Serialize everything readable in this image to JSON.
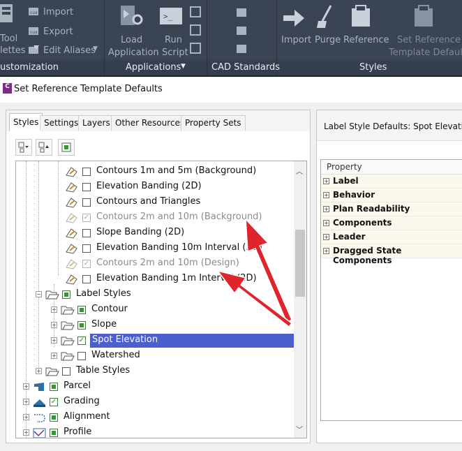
{
  "ribbon": {
    "customization": {
      "items": [
        "Import",
        "Export",
        "Edit Aliases"
      ],
      "left_fragments": [
        "Tool",
        "lettes"
      ],
      "title": "ustomization"
    },
    "applications": {
      "load_line1": "Load",
      "load_line2": "Application",
      "run_line1": "Run",
      "run_line2": "Script",
      "title": "Applications"
    },
    "cad_standards": {
      "title": "CAD Standards"
    },
    "styles": {
      "import": "Import",
      "purge": "Purge",
      "reference": "Reference",
      "set_ref_line1": "Set Reference",
      "set_ref_line2": "Template Defaults",
      "title": "Styles"
    }
  },
  "dialog": {
    "app_letter": "C",
    "title": "Set Reference Template Defaults"
  },
  "tabs": [
    "Styles",
    "Settings",
    "Layers",
    "Other Resources",
    "Property Sets"
  ],
  "tree": [
    {
      "label": "Contours 1m and 5m (Background)",
      "dim": false
    },
    {
      "label": "Elevation Banding (2D)",
      "dim": false
    },
    {
      "label": "Contours and Triangles",
      "dim": false
    },
    {
      "label": "Contours 2m and 10m (Background)",
      "dim": true
    },
    {
      "label": "Slope Banding (2D)",
      "dim": false
    },
    {
      "label": "Elevation Banding 10m Interval (2D)",
      "dim": false
    },
    {
      "label": "Contours 2m and 10m (Design)",
      "dim": true
    },
    {
      "label": "Elevation Banding 1m Interval (2D)",
      "dim": false
    },
    {
      "label": "Label Styles"
    },
    {
      "label": "Contour"
    },
    {
      "label": "Slope"
    },
    {
      "label": "Spot Elevation",
      "selected": true
    },
    {
      "label": "Watershed"
    },
    {
      "label": "Table Styles"
    },
    {
      "label": "Parcel"
    },
    {
      "label": "Grading"
    },
    {
      "label": "Alignment"
    },
    {
      "label": "Profile"
    }
  ],
  "right": {
    "heading": "Label Style Defaults: Spot Elevation",
    "column": "Property",
    "groups": [
      "Label",
      "Behavior",
      "Plan Readability",
      "Components",
      "Leader",
      "Dragged State Components"
    ]
  },
  "colors": {
    "ribbon": "#3b4453",
    "selection": "#4b5fcf",
    "arrow": "#e0242b"
  }
}
